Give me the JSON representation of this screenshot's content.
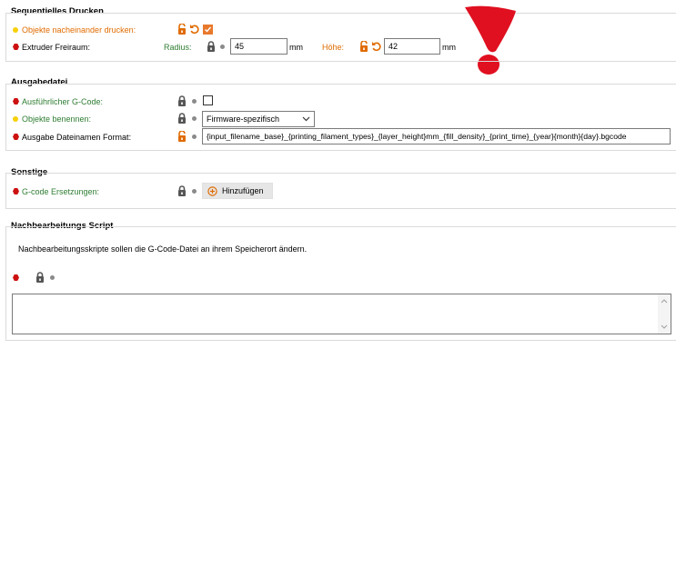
{
  "sections": {
    "sequential": {
      "title": "Sequentielles Drucken",
      "objects_label": "Objekte nacheinander drucken:",
      "extruder_label": "Extruder Freiraum:",
      "radius_label": "Radius:",
      "radius_value": "45",
      "radius_unit": "mm",
      "height_label": "Höhe:",
      "height_value": "42",
      "height_unit": "mm"
    },
    "output": {
      "title": "Ausgabedatei",
      "verbose_label": "Ausführlicher G-Code:",
      "label_objects_label": "Objekte benennen:",
      "label_objects_value": "Firmware-spezifisch",
      "filename_label": "Ausgabe Dateinamen Format:",
      "filename_value": "{input_filename_base}_{printing_filament_types}_{layer_height}mm_{fill_density}_{print_time}_{year}{month}{day}.bgcode"
    },
    "other": {
      "title": "Sonstige",
      "gcode_subst_label": "G-code Ersetzungen:",
      "add_button_label": "Hinzufügen"
    },
    "post": {
      "title": "Nachbearbeitungs Script",
      "description": "Nachbearbeitungsskripte sollen die G-Code-Datei an ihrem Speicherort ändern."
    }
  },
  "colors": {
    "accent_orange": "#e06b00",
    "label_green": "#2e7d32",
    "hex_red": "#cc1111",
    "dot_yellow": "#f7d00a",
    "exclamation_red": "#e01020"
  }
}
